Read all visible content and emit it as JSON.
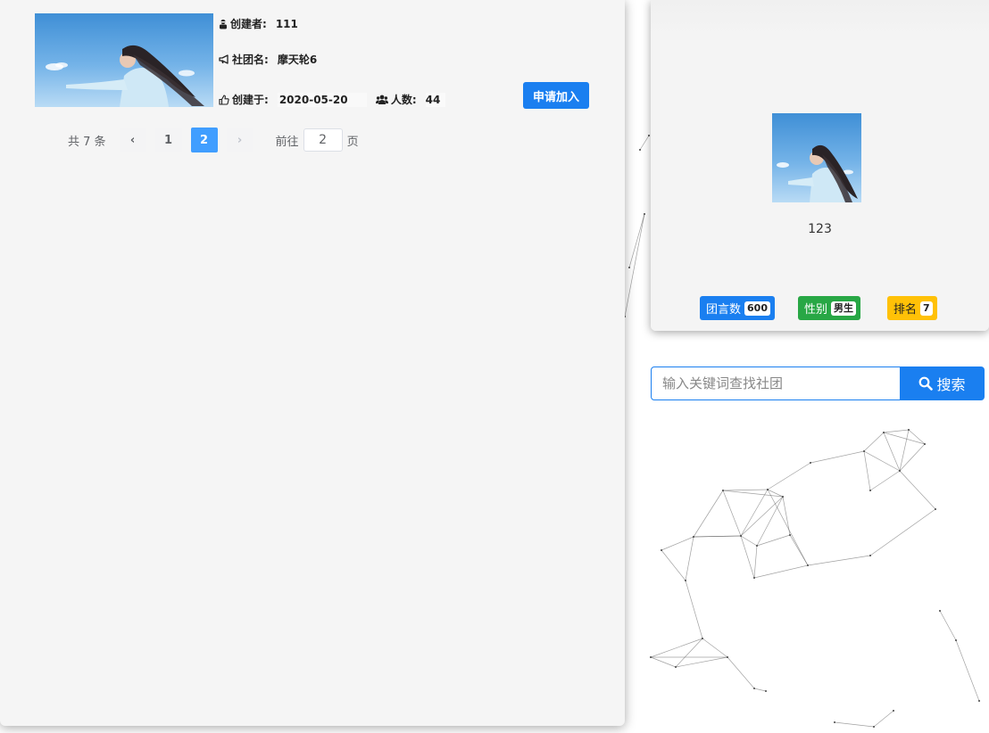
{
  "club": {
    "creator_label": "创建者:",
    "creator": "111",
    "name_label": "社团名:",
    "name": "摩天轮6",
    "created_label": "创建于:",
    "created": "2020-05-20",
    "members_label": "人数:",
    "members": "44",
    "join_label": "申请加入"
  },
  "pagination": {
    "total": "共 7 条",
    "prev": "‹",
    "pages": [
      "1",
      "2"
    ],
    "next": "›",
    "goto_label": "前往",
    "goto_value": "2",
    "page_suffix": "页"
  },
  "profile": {
    "username": "123",
    "badges": [
      {
        "label": "团言数",
        "count": "600",
        "color": "#1a7ff0"
      },
      {
        "label": "性别",
        "count": "男生",
        "color": "#28a745"
      },
      {
        "label": "排名",
        "count": "7",
        "color": "#ffc107"
      }
    ]
  },
  "search": {
    "placeholder": "输入关键词查找社团",
    "button_label": "搜索"
  },
  "icons": {
    "creator": "user-secret-icon",
    "name": "bullhorn-icon",
    "created": "thumbs-up-icon",
    "members": "users-icon",
    "search": "search-icon"
  },
  "colors": {
    "primary": "#1a7ff0",
    "pagination_active": "#409eff",
    "success": "#28a745",
    "warning": "#ffc107"
  }
}
